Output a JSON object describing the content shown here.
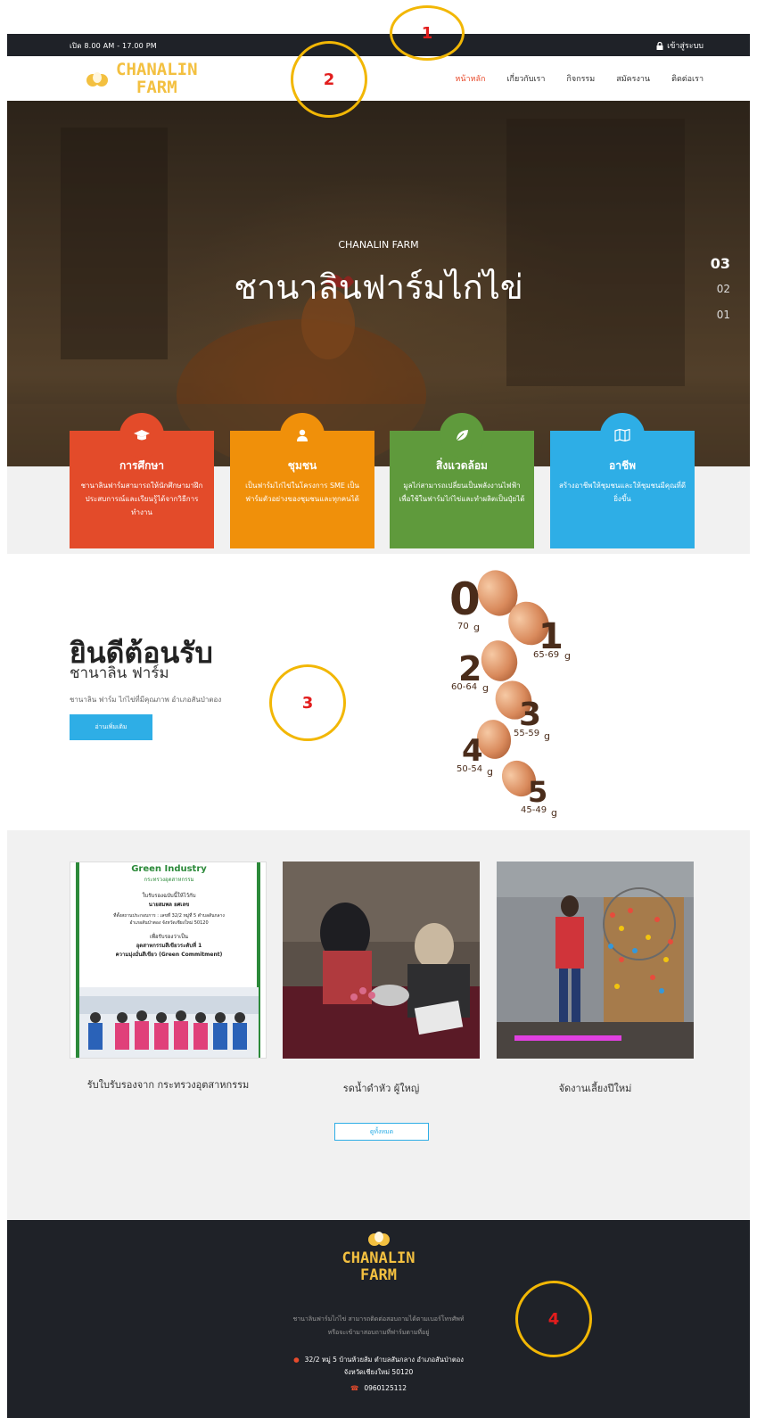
{
  "topbar": {
    "hours": "เปิด 8.00 AM - 17.00 PM",
    "login_label": "เข้าสู่ระบบ",
    "login_icon": "lock-icon"
  },
  "brand": {
    "line1": "CHANALIN",
    "line2": "FARM",
    "color": "#f3c040"
  },
  "nav": {
    "items": [
      "หน้าหลัก",
      "เกี่ยวกับเรา",
      "กิจกรรม",
      "สมัครงาน",
      "ติดต่อเรา"
    ],
    "active": "หน้าหลัก",
    "active_color": "#e84b2c"
  },
  "hero": {
    "subtitle": "CHANALIN FARM",
    "title": "ชานาลินฟาร์มไก่ไข่",
    "slides": [
      "03",
      "02",
      "01"
    ]
  },
  "features": [
    {
      "icon": "graduation-cap-icon",
      "title": "การศึกษา",
      "desc": "ชานาลินฟาร์มสามารถให้นักศึกษามาฝึกประสบการณ์และเรียนรู้ได้จากวิธีการทำงาน",
      "color": "#e34b2a"
    },
    {
      "icon": "user-icon",
      "title": "ชุมชน",
      "desc": "เป็นฟาร์มไก่ไข่ในโครงการ SME เป็นฟาร์มตัวอย่างของชุมชนและทุกคนได้",
      "color": "#f0900a"
    },
    {
      "icon": "leaf-icon",
      "title": "สิ่งแวดล้อม",
      "desc": "มูลไก่สามารถเปลี่ยนเป็นพลังงานไฟฟ้าเพื่อใช้ในฟาร์มไก่ไข่และทำผลิตเป็นปุ๋ยได้",
      "color": "#5f9a3c"
    },
    {
      "icon": "map-icon",
      "title": "อาชีพ",
      "desc": "สร้างอาชีพให้ชุมชนและให้ชุมชนมีคุณที่ดียิ่งขึ้น",
      "color": "#2eaee6"
    }
  ],
  "welcome": {
    "heading": "ยินดีต้อนรับ",
    "subheading": "ชานาลิน ฟาร์ม",
    "desc": "ชานาลิน ฟาร์ม ไก่ไข่ที่มีคุณภาพ อำเภอสันป่าตอง",
    "button": "อ่านเพิ่มเติม",
    "egg_sizes": [
      {
        "num": "0",
        "weight": "70",
        "unit": "g"
      },
      {
        "num": "1",
        "weight": "65-69",
        "unit": "g"
      },
      {
        "num": "2",
        "weight": "60-64",
        "unit": "g"
      },
      {
        "num": "3",
        "weight": "55-59",
        "unit": "g"
      },
      {
        "num": "4",
        "weight": "50-54",
        "unit": "g"
      },
      {
        "num": "5",
        "weight": "45-49",
        "unit": "g"
      }
    ]
  },
  "gallery": {
    "items": [
      {
        "caption": "รับใบรับรองจาก กระทรวงอุตสาหกรรม"
      },
      {
        "caption": "รดน้ำดำหัว ผู้ใหญ่"
      },
      {
        "caption": "จัดงานเลี้ยงปีใหม่"
      }
    ],
    "certificate": {
      "header": "Green Industry",
      "header_sub": "กระทรวงอุตสาหกรรม",
      "l1": "ใบรับรองฉบับนี้ให้ไว้กับ",
      "l2": "นายสมพล ยศเลข",
      "l3": "ที่ตั้งสถานประกอบการ : เลขที่ 32/2 หมู่ที่ 5 ตำบลสันกลาง",
      "l4": "อำเภอสันป่าตอง จังหวัดเชียงใหม่ 50120",
      "l5": "เพื่อรับรองว่าเป็น",
      "l6": "อุตสาหกรรมสีเขียวระดับที่ 1",
      "l7": "ความมุ่งมั่นสีเขียว (Green Commitment)"
    },
    "view_all": "ดูทั้งหมด"
  },
  "footer": {
    "desc_line1": "ชานาลินฟาร์มไก่ไข่ สามารถติดต่อสอบถามได้ตามเบอร์โทรศัพท์",
    "desc_line2": "หรือจะเข้ามาสอบถามที่ฟาร์มตามที่อยู่",
    "address_line1": "32/2 หมู่ 5 บ้านห้วยส้ม ตำบลสันกลาง อำเภอสันป่าตอง",
    "address_line2": "จังหวัดเชียงใหม่ 50120",
    "phone": "0960125112"
  },
  "annotations": [
    "1",
    "2",
    "3",
    "4"
  ]
}
